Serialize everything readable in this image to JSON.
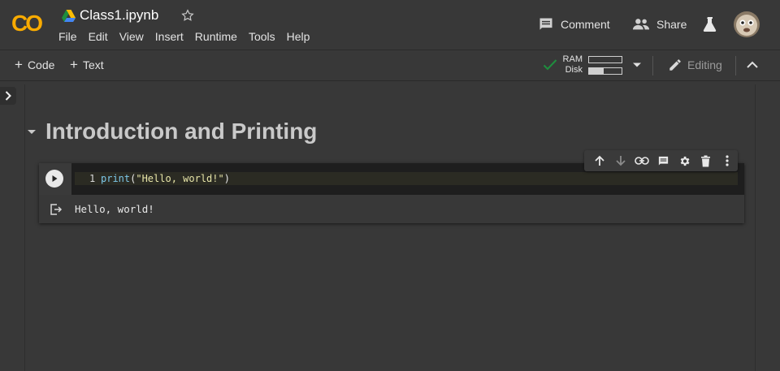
{
  "app": {
    "logo_text": "CO",
    "brand_color": "#f9ab00"
  },
  "document": {
    "title": "Class1.ipynb"
  },
  "menu": [
    "File",
    "Edit",
    "View",
    "Insert",
    "Runtime",
    "Tools",
    "Help"
  ],
  "header_actions": {
    "comment_label": "Comment",
    "share_label": "Share"
  },
  "toolbar": {
    "add_code_label": "Code",
    "add_text_label": "Text",
    "ram_label": "RAM",
    "disk_label": "Disk",
    "ram_usage": 0.0,
    "disk_usage": 0.45,
    "editing_label": "Editing",
    "status_color": "#1e8e3e"
  },
  "notebook": {
    "section_title": "Introduction and Printing",
    "cell": {
      "line_number": "1",
      "code_fn": "print",
      "code_open": "(",
      "code_string": "\"Hello, world!\"",
      "code_close": ")",
      "output": "Hello, world!"
    }
  },
  "icons": {
    "cell_toolbar": [
      "arrow-up-icon",
      "arrow-down-icon",
      "link-icon",
      "comment-icon",
      "gear-icon",
      "trash-icon",
      "more-vert-icon"
    ]
  }
}
